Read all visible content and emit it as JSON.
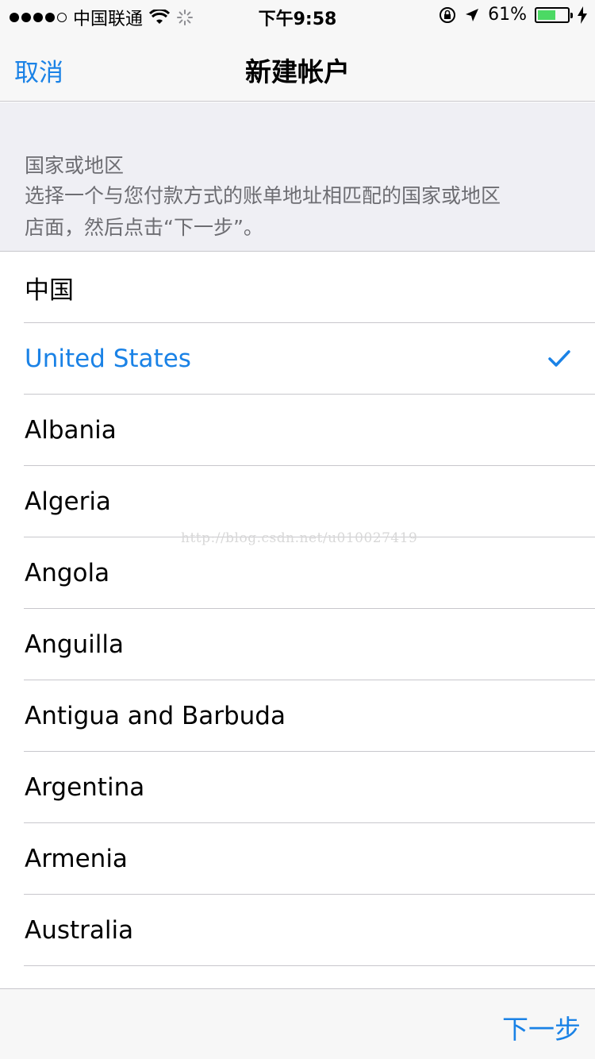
{
  "status_bar": {
    "carrier": "中国联通",
    "time": "下午9:58",
    "battery": "61%",
    "battery_level": 0.61
  },
  "nav": {
    "cancel": "取消",
    "title": "新建帐户"
  },
  "section": {
    "title": "国家或地区",
    "description_line1": "选择一个与您付款方式的账单地址相匹配的国家或地区",
    "description_line2": "店面，然后点击“下一步”。"
  },
  "countries": [
    {
      "label": "中国"
    },
    {
      "label": "United States",
      "selected": true
    },
    {
      "label": "Albania"
    },
    {
      "label": "Algeria"
    },
    {
      "label": "Angola"
    },
    {
      "label": "Anguilla"
    },
    {
      "label": "Antigua and Barbuda"
    },
    {
      "label": "Argentina"
    },
    {
      "label": "Armenia"
    },
    {
      "label": "Australia"
    }
  ],
  "watermark": "http://blog.csdn.net/u010027419",
  "toolbar": {
    "next": "下一步"
  },
  "colors": {
    "accent": "#1a82e6",
    "battery": "#4cd964"
  }
}
